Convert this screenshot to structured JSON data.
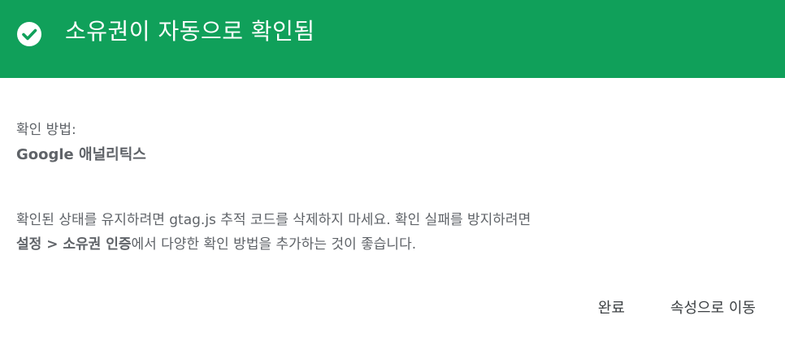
{
  "header": {
    "icon": "check-circle-icon",
    "title": "소유권이 자동으로 확인됨",
    "background": "#10a05a"
  },
  "method": {
    "label": "확인 방법:",
    "value": "Google 애널리틱스"
  },
  "message": {
    "line1": "확인된 상태를 유지하려면 gtag.js 추적 코드를 삭제하지 마세요. 확인 실패를 방지하려면",
    "line2_bold": "설정 > 소유권 인증",
    "line2_rest": "에서 다양한 확인 방법을 추가하는 것이 좋습니다."
  },
  "actions": {
    "done_label": "완료",
    "goto_property_label": "속성으로 이동"
  }
}
